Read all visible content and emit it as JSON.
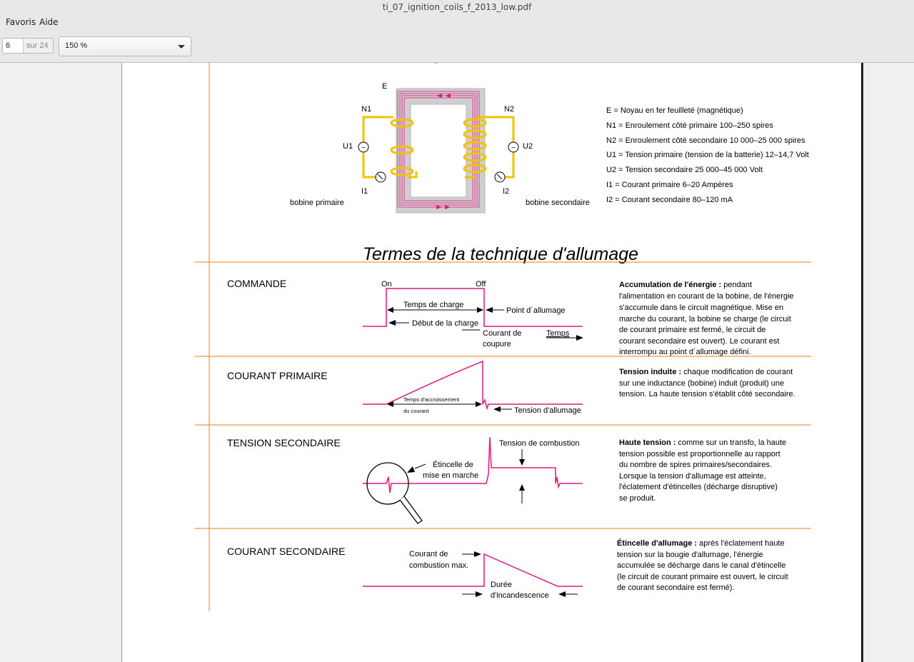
{
  "window": {
    "title": "ti_07_ignition_coils_f_2013_low.pdf"
  },
  "menu": {
    "items": [
      "Favoris",
      "Aide"
    ]
  },
  "toolbar": {
    "page_current": "6",
    "page_total": "sur 24",
    "zoom": "150 %"
  },
  "figure": {
    "labels": {
      "E": "E",
      "N1": "N1",
      "N2": "N2",
      "U1": "U1",
      "U2": "U2",
      "I1": "I1",
      "I2": "I2",
      "primary": "bobine primaire",
      "secondary": "bobine secondaire"
    },
    "legend": [
      "E   = Noyau en fer feuilleté (magnétique)",
      "N1 = Enroulement côté primaire 100–250 spires",
      "N2 = Enroulement côté secondaire 10 000–25 000 spires",
      "U1 = Tension primaire (tension de la batterie) 12–14,7 Volt",
      "U2 = Tension secondaire 25 000–45 000 Volt",
      "I1   = Courant primaire 6–20 Ampères",
      "I2   = Courant secondaire 80–120 mA"
    ]
  },
  "section_title": "Termes de la technique d'allumage",
  "rows": [
    {
      "heading": "COMMANDE",
      "labels": {
        "on": "On",
        "off": "Off",
        "charge": "Temps de charge",
        "debut": "Début de la charge",
        "point": "Point d´allumage",
        "coupure1": "Courant de",
        "coupure2": "coupure",
        "temps": "Temps"
      },
      "title": "Accumulation de l'énergie :",
      "lines": [
        " pendant",
        "l'alimentation en courant de la bobine, de l'énergie",
        "s'accumule dans le circuit magnétique. Mise en",
        "marche du courant, la bobine se charge (le circuit",
        "de courant primaire est fermé, le circuit de",
        "courant secondaire est ouvert). Le courant est",
        "interrompu au point d´allumage défini."
      ]
    },
    {
      "heading": "COURANT PRIMAIRE",
      "labels": {
        "accroissement1": "Temps d'accroissement",
        "accroissement2": "du courant",
        "tension": "Tension d'allumage"
      },
      "title": "Tension induite :",
      "lines": [
        " chaque modification de courant",
        "sur une inductance (bobine) induit (produit) une",
        "tension. La haute tension s'établit côté secondaire."
      ]
    },
    {
      "heading": "TENSION SECONDAIRE",
      "labels": {
        "combustion": "Tension de combustion",
        "etincelle1": "Étincelle de",
        "etincelle2": "mise en marche"
      },
      "title": "Haute tension :",
      "lines": [
        " comme sur un transfo, la haute",
        "tension possible est proportionnelle au rapport",
        "du nombre de spires primaires/secondaires.",
        "Lorsque la tension d'allumage est atteinte,",
        "l'éclatement d'étincelles (décharge disruptive)",
        "se produit."
      ]
    },
    {
      "heading": "COURANT SECONDAIRE",
      "labels": {
        "courant1": "Courant de",
        "courant2": "combustion max.",
        "duree1": "Durée",
        "duree2": "d'incandescence"
      },
      "title": "Étincelle d'allumage :",
      "lines": [
        " après l'éclatement haute",
        "tension sur la bougie d'allumage, l'énergie",
        "accumulée se décharge dans le canal d'étincelle",
        "(le circuit de courant primaire est ouvert, le circuit",
        "de courant secondaire est fermé)."
      ]
    }
  ],
  "colors": {
    "accent": "#e8820e",
    "signal": "#e0197d",
    "coil": "#f2c200",
    "core": "#c8c8c8"
  }
}
